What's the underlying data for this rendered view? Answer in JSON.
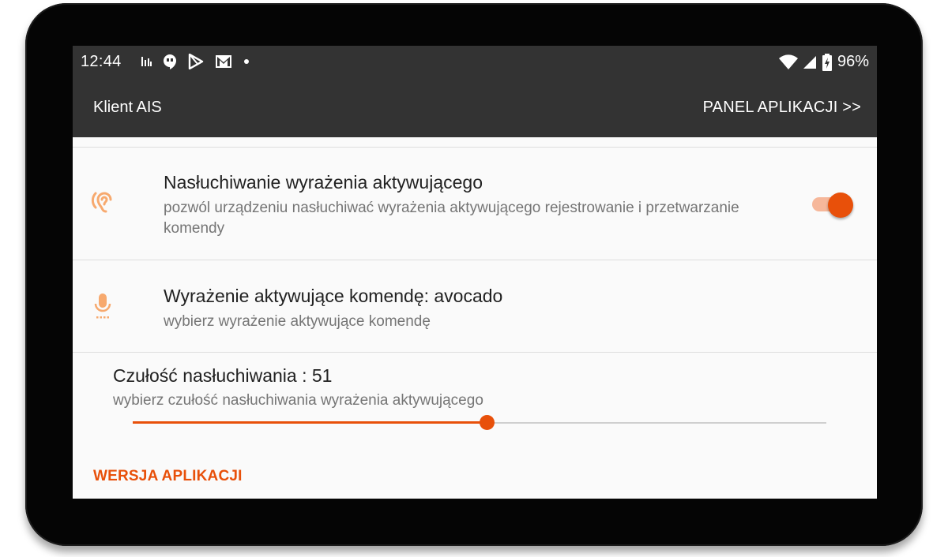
{
  "status_bar": {
    "time": "12:44",
    "battery": "96%",
    "left_icons": [
      "signal-bars-icon",
      "hangouts-icon",
      "play-store-icon",
      "gmail-icon",
      "dot-icon"
    ],
    "right_icons": [
      "wifi-icon",
      "cell-signal-icon",
      "battery-charging-icon"
    ]
  },
  "toolbar": {
    "title": "Klient AIS",
    "action": "PANEL APLIKACJI >>"
  },
  "preferences": {
    "hotword_listen": {
      "icon": "ear-icon",
      "title": "Nasłuchiwanie wyrażenia aktywującego",
      "summary": "pozwól urządzeniu nasłuchiwać wyrażenia aktywującego rejestrowanie i przetwarzanie komendy",
      "enabled": true
    },
    "hotword_phrase": {
      "icon": "microphone-icon",
      "title": "Wyrażenie aktywujące komendę: avocado",
      "summary": "wybierz wyrażenie aktywujące komendę"
    },
    "sensitivity": {
      "title": "Czułość nasłuchiwania : 51",
      "summary": "wybierz czułość nasłuchiwania wyrażenia aktywującego",
      "value": 51,
      "max": 100
    }
  },
  "section_header": "WERSJA APLIKACJI",
  "colors": {
    "accent": "#e8500a",
    "icon_tint": "#f7a96e",
    "bar_background": "#333333",
    "screen_background": "#fafafa"
  }
}
